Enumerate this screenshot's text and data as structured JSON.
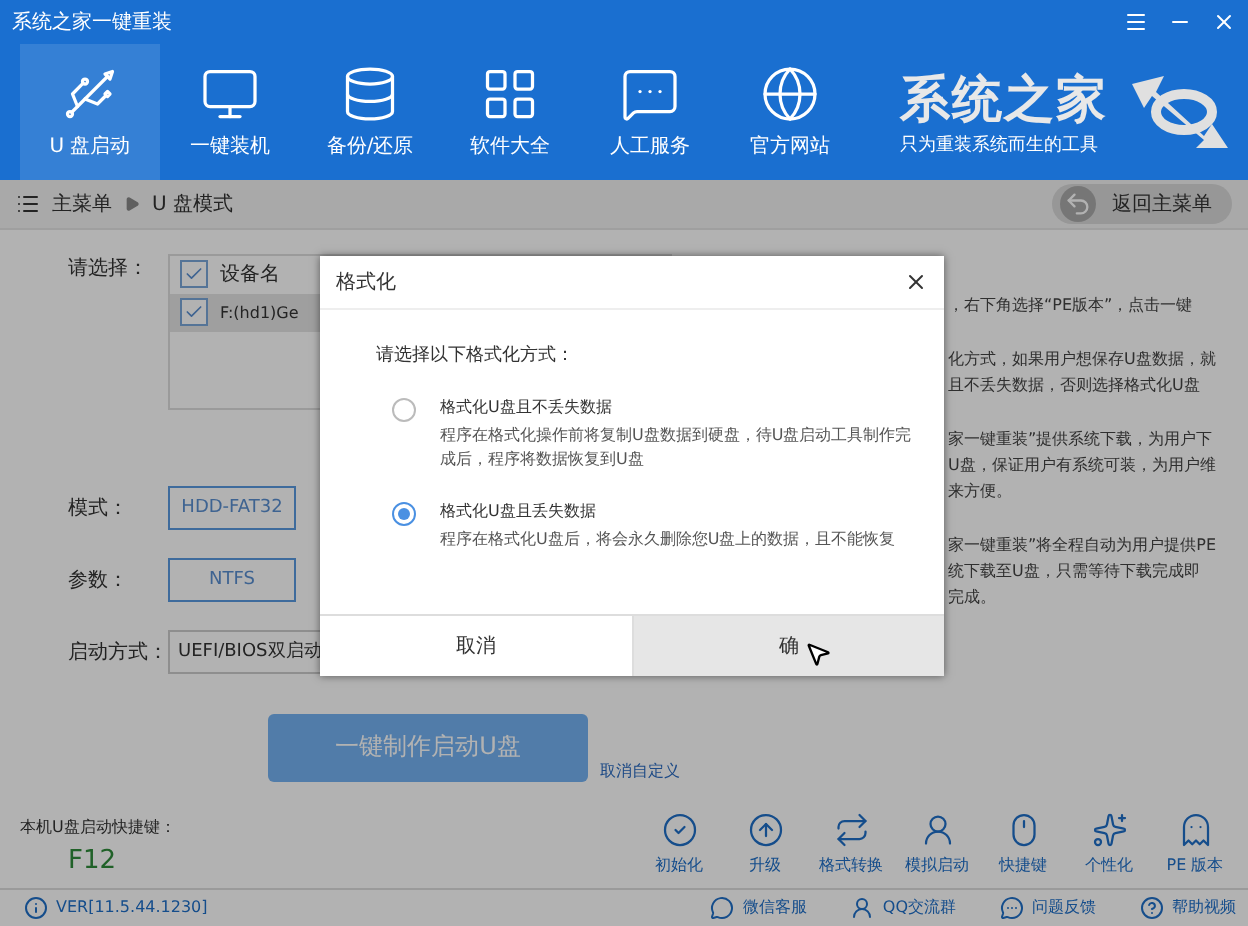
{
  "window": {
    "title": "系统之家一键重装"
  },
  "nav": [
    {
      "label": "U 盘启动",
      "selected": true,
      "kind": "usb"
    },
    {
      "label": "一键装机",
      "selected": false,
      "kind": "monitor"
    },
    {
      "label": "备份/还原",
      "selected": false,
      "kind": "database"
    },
    {
      "label": "软件大全",
      "selected": false,
      "kind": "grid"
    },
    {
      "label": "人工服务",
      "selected": false,
      "kind": "chat"
    },
    {
      "label": "官方网站",
      "selected": false,
      "kind": "globe"
    }
  ],
  "logo": {
    "name": "系统之家",
    "slogan": "只为重装系统而生的工具"
  },
  "breadcrumb": [
    "主菜单",
    "U 盘模式"
  ],
  "back_button": "返回主菜单",
  "form": {
    "select_label": "请选择：",
    "header_checked": true,
    "column": "设备名",
    "rows": [
      {
        "device": "F:(hd1)Ge",
        "checked": true
      }
    ],
    "fields": [
      {
        "label": "模式：",
        "value": "HDD-FAT32"
      },
      {
        "label": "参数：",
        "value": "NTFS"
      },
      {
        "label": "启动方式：",
        "value": "UEFI/BIOS双启动"
      }
    ],
    "make_button": "一键制作启动U盘",
    "cancel_link": "取消自定义"
  },
  "help_text": [
    [
      "，右下角选择“PE版本”，点击一键"
    ],
    [
      "化方式，如果用户想保存U盘数据，就",
      "且不丢失数据，否则选择格式化U盘"
    ],
    [
      "家一键重装”提供系统下载，为用户下",
      "U盘，保证用户有系统可装，为用户维",
      "来方便。"
    ],
    [
      "家一键重装”将全程自动为用户提供PE",
      "统下载至U盘，只需等待下载完成即",
      "完成。"
    ]
  ],
  "hotkey": {
    "label": "本机U盘启动快捷键：",
    "key": "F12"
  },
  "tools": [
    {
      "label": "初始化",
      "kind": "check"
    },
    {
      "label": "升级",
      "kind": "up"
    },
    {
      "label": "格式转换",
      "kind": "convert"
    },
    {
      "label": "模拟启动",
      "kind": "user"
    },
    {
      "label": "快捷键",
      "kind": "mouse"
    },
    {
      "label": "个性化",
      "kind": "sparkle"
    },
    {
      "label": "PE 版本",
      "kind": "pe"
    }
  ],
  "status_bar": {
    "version": "VER[11.5.44.1230]",
    "links": [
      {
        "label": "微信客服",
        "kind": "wechat"
      },
      {
        "label": "QQ交流群",
        "kind": "qq"
      },
      {
        "label": "问题反馈",
        "kind": "feedback"
      },
      {
        "label": "帮助视频",
        "kind": "help"
      }
    ]
  },
  "dialog": {
    "title": "格式化",
    "prompt": "请选择以下格式化方式：",
    "options": [
      {
        "title": "格式化U盘且不丢失数据",
        "description": "程序在格式化操作前将复制U盘数据到硬盘，待U盘启动工具制作完成后，程序将数据恢复到U盘",
        "selected": false
      },
      {
        "title": "格式化U盘且丢失数据",
        "description": "程序在格式化U盘后，将会永久删除您U盘上的数据，且不能恢复",
        "selected": true
      }
    ],
    "buttons": [
      {
        "label": "取消",
        "hovered": false
      },
      {
        "label": "确",
        "hovered": true
      }
    ]
  }
}
